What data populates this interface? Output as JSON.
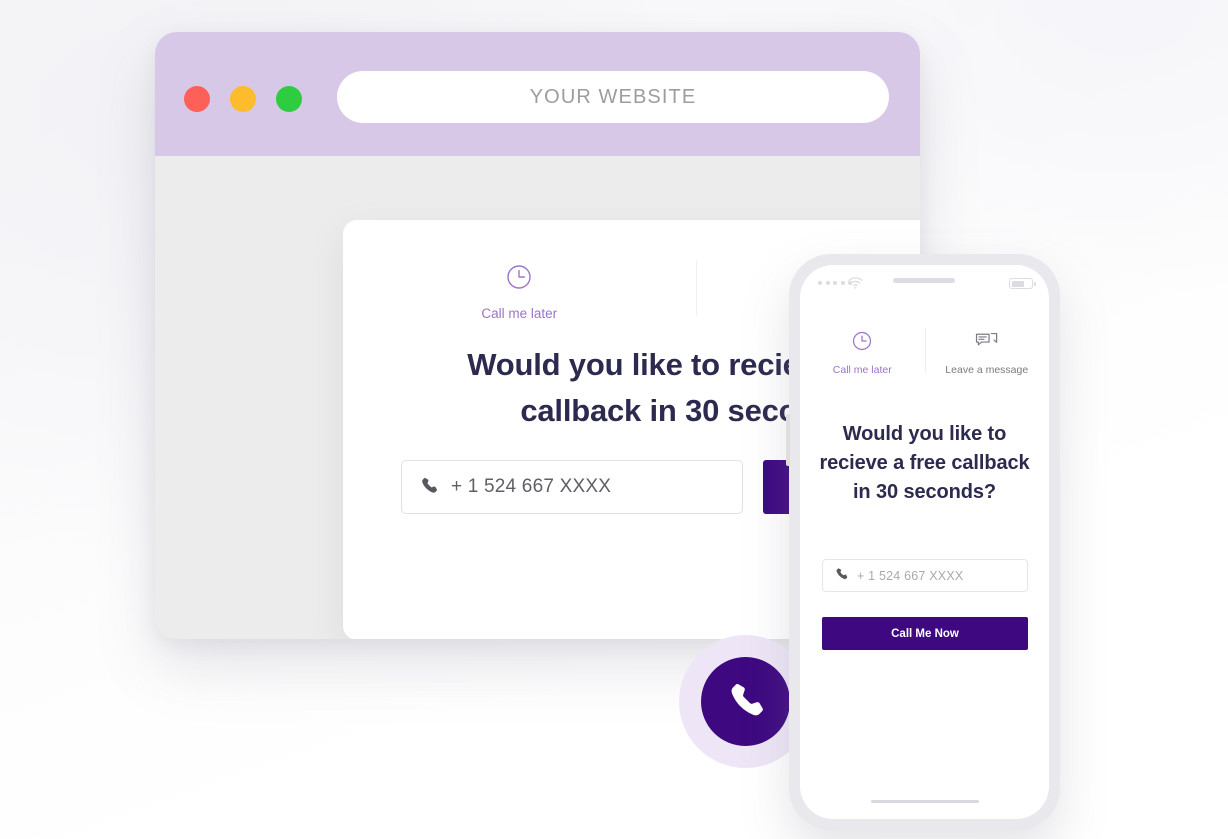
{
  "browser": {
    "url_text": "YOUR WEBSITE",
    "traffic_lights": [
      {
        "name": "close",
        "color": "#fc6058"
      },
      {
        "name": "minimize",
        "color": "#fdbc2c"
      },
      {
        "name": "maximize",
        "color": "#2ecc40"
      }
    ]
  },
  "widget": {
    "close_label": "×",
    "tabs": [
      {
        "label": "Call me later",
        "icon": "clock-icon",
        "active": true
      },
      {
        "label": "Leave a message",
        "icon": "chat-bubbles-icon",
        "active": false
      }
    ],
    "headline": "Would you like to recieve a free callback in 30 seconds?",
    "phone_input": {
      "value": "+ 1 524 667 XXXX",
      "placeholder": "+ 1 524 667 XXXX",
      "icon": "phone-icon"
    },
    "cta_label": "Call Me Now"
  },
  "phone": {
    "status_bar": {
      "signal_dots": 5,
      "wifi_icon": "wifi-icon",
      "battery_icon": "battery-icon"
    },
    "tabs": [
      {
        "label": "Call me later",
        "icon": "clock-icon",
        "active": true
      },
      {
        "label": "Leave a message",
        "icon": "chat-bubbles-icon",
        "active": false
      }
    ],
    "headline": "Would you like to recieve a free callback in 30 seconds?",
    "phone_input": {
      "value": "+ 1 524 667 XXXX",
      "placeholder": "+ 1 524 667 XXXX",
      "icon": "phone-icon"
    },
    "cta_label": "Call Me Now"
  },
  "call_bubble": {
    "icon": "phone-handset-icon"
  },
  "colors": {
    "brand_purple": "#3d0880",
    "accent_light_purple": "#9d73c9",
    "chrome_lavender": "#d8c8e8",
    "bubble_halo": "#eee6f6",
    "headline_navy": "#2c2a4e"
  }
}
